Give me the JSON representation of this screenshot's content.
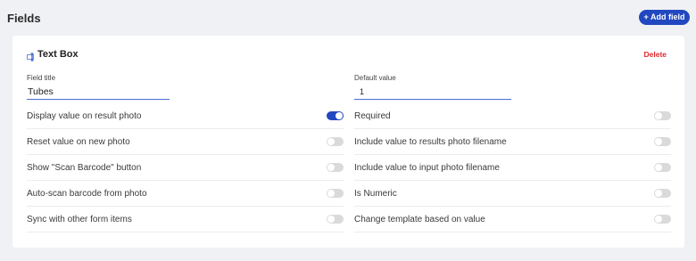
{
  "header": {
    "title": "Fields",
    "add_button_label": "+ Add field"
  },
  "card": {
    "title": "Text Box",
    "delete_label": "Delete",
    "field_title": {
      "label": "Field title",
      "value": "Tubes"
    },
    "default_value": {
      "label": "Default value",
      "value": "1"
    },
    "left_options": [
      {
        "label": "Display value on result photo",
        "on": true
      },
      {
        "label": "Reset value on new photo",
        "on": false
      },
      {
        "label": "Show \"Scan Barcode\" button",
        "on": false
      },
      {
        "label": "Auto-scan barcode from photo",
        "on": false
      },
      {
        "label": "Sync with other form items",
        "on": false
      }
    ],
    "right_options": [
      {
        "label": "Required",
        "on": false
      },
      {
        "label": "Include value to results photo filename",
        "on": false
      },
      {
        "label": "Include value to input photo filename",
        "on": false
      },
      {
        "label": "Is Numeric",
        "on": false
      },
      {
        "label": "Change template based on value",
        "on": false
      }
    ]
  },
  "colors": {
    "accent": "#2148c0",
    "delete": "#e0282e",
    "toggle_off": "#dadada",
    "background": "#f0f1f4"
  }
}
